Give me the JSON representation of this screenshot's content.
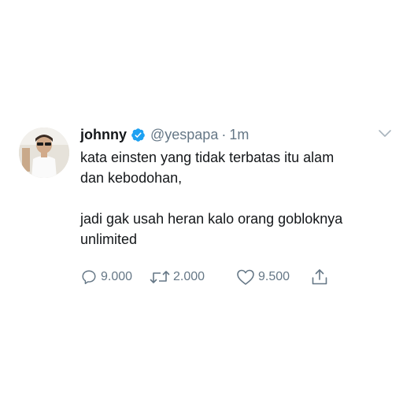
{
  "tweet": {
    "author_name": "johnny",
    "handle": "@yespapa",
    "separator": "·",
    "time": "1m",
    "paragraphs": [
      "kata einsten yang tidak terbatas itu alam\ndan kebodohan,",
      "jadi gak usah heran kalo orang gobloknya\nunlimited"
    ],
    "reply_count": "9.000",
    "retweet_count": "2.000",
    "like_count": "9.500",
    "icons": {
      "verified": "verified-badge-icon",
      "menu": "chevron-down-icon",
      "reply": "reply-icon",
      "retweet": "retweet-icon",
      "like": "heart-icon",
      "share": "share-icon"
    },
    "colors": {
      "verified": "#1da1f2",
      "text": "#14171a",
      "secondary": "#657786"
    }
  }
}
